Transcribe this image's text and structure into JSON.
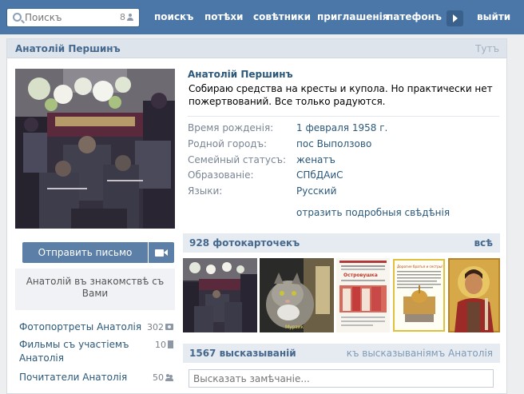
{
  "header": {
    "search_placeholder": "Поискъ",
    "search_count": "8",
    "nav": [
      "поискъ",
      "потѣхи",
      "совѣтники",
      "приглашенія",
      "патефонъ",
      "выйти"
    ]
  },
  "profile_panel": {
    "title": "Анатолій Першинъ",
    "top_link": "Тутъ"
  },
  "profile": {
    "name": "Анатолій Першинъ",
    "status": "Собираю средства на кресты и купола. Но практически нет пожертвований. Все только радуются.",
    "info": [
      {
        "label": "Время рожденія:",
        "value": "1 февраля 1958 г."
      },
      {
        "label": "Родной городъ:",
        "value": "пос Выползово"
      },
      {
        "label": "Семейный статусъ:",
        "value": "женатъ"
      },
      {
        "label": "Образованіе:",
        "value": "СПбДАиС"
      },
      {
        "label": "Языки:",
        "value": "Русский"
      }
    ],
    "more_link": "отразить подробныя свѣдѣнія"
  },
  "actions": {
    "send_message": "Отправить письмо",
    "friend_status": "Анатолій въ знакомствѣ съ Вами"
  },
  "left_links": [
    {
      "label": "Фотопортреты Анатолія",
      "count": "302",
      "icon": "camera-icon"
    },
    {
      "label": "Фильмы съ участіемъ Анатолія",
      "count": "10",
      "icon": "film-icon"
    },
    {
      "label": "Почитатели Анатолія",
      "count": "50",
      "icon": "people-icon"
    }
  ],
  "photos": {
    "title": "928 фотокарточекъ",
    "all_link": "всѣ",
    "items": [
      {
        "caption": ""
      },
      {
        "caption": "Мурзик"
      },
      {
        "caption": "Островушка"
      },
      {
        "caption": "Дорогие братья и сестры!"
      },
      {
        "caption": ""
      }
    ]
  },
  "wall": {
    "title": "1567 высказываній",
    "link": "къ высказываніямъ Анатолія",
    "input_placeholder": "Высказать замѣчаніе..."
  },
  "colors": {
    "header_bg": "#4a76a8",
    "link": "#2b587a",
    "button": "#5b7fa6",
    "section_head": "#e5ebf1"
  }
}
